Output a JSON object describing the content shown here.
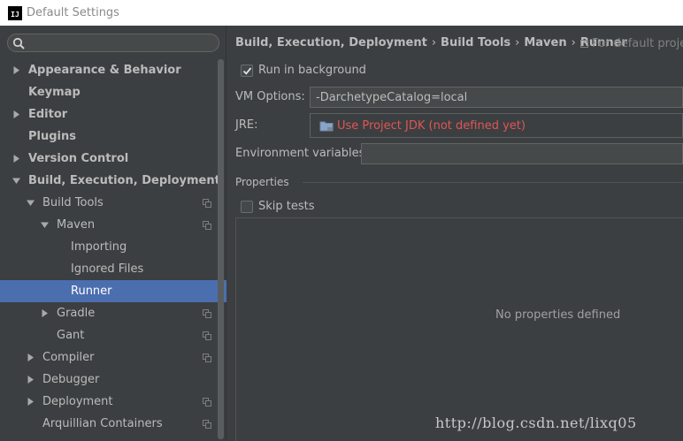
{
  "window": {
    "title": "Default Settings",
    "app_icon_text": "IJ"
  },
  "search": {
    "placeholder": ""
  },
  "tree": [
    {
      "label": "Appearance & Behavior",
      "bold": true,
      "arrow": "right",
      "level": 0
    },
    {
      "label": "Keymap",
      "bold": true,
      "arrow": null,
      "level": 0
    },
    {
      "label": "Editor",
      "bold": true,
      "arrow": "right",
      "level": 0
    },
    {
      "label": "Plugins",
      "bold": true,
      "arrow": null,
      "level": 0
    },
    {
      "label": "Version Control",
      "bold": true,
      "arrow": "right",
      "level": 0
    },
    {
      "label": "Build, Execution, Deployment",
      "bold": true,
      "arrow": "down",
      "level": 0
    },
    {
      "label": "Build Tools",
      "bold": false,
      "arrow": "down",
      "level": 1,
      "copy": true
    },
    {
      "label": "Maven",
      "bold": false,
      "arrow": "down",
      "level": 2,
      "copy": true
    },
    {
      "label": "Importing",
      "bold": false,
      "arrow": null,
      "level": 3
    },
    {
      "label": "Ignored Files",
      "bold": false,
      "arrow": null,
      "level": 3
    },
    {
      "label": "Runner",
      "bold": false,
      "arrow": null,
      "level": 3,
      "selected": true
    },
    {
      "label": "Gradle",
      "bold": false,
      "arrow": "right",
      "level": 2,
      "copy": true
    },
    {
      "label": "Gant",
      "bold": false,
      "arrow": null,
      "level": 2,
      "copy": true
    },
    {
      "label": "Compiler",
      "bold": false,
      "arrow": "right",
      "level": 1,
      "copy": true
    },
    {
      "label": "Debugger",
      "bold": false,
      "arrow": "right",
      "level": 1
    },
    {
      "label": "Deployment",
      "bold": false,
      "arrow": "right",
      "level": 1,
      "copy": true
    },
    {
      "label": "Arquillian Containers",
      "bold": false,
      "arrow": null,
      "level": 1,
      "copy": true
    }
  ],
  "breadcrumb": [
    "Build, Execution, Deployment",
    "Build Tools",
    "Maven",
    "Runner"
  ],
  "breadcrumb_sep": "›",
  "for_default": "For default projec",
  "runner": {
    "run_in_background": {
      "label": "Run in background",
      "checked": true
    },
    "vm_options": {
      "label": "VM Options:",
      "value": "-DarchetypeCatalog=local"
    },
    "jre": {
      "label": "JRE:",
      "value": "Use Project JDK (not defined yet)"
    },
    "env_vars": {
      "label": "Environment variables:",
      "value": ""
    },
    "properties": {
      "title": "Properties",
      "skip_tests": {
        "label": "Skip tests",
        "checked": false
      },
      "empty_text": "No properties defined"
    }
  },
  "watermark": "http://blog.csdn.net/lixq05",
  "colors": {
    "selection": "#4b6eaf",
    "error_text": "#e05555",
    "background": "#3c3f41"
  }
}
